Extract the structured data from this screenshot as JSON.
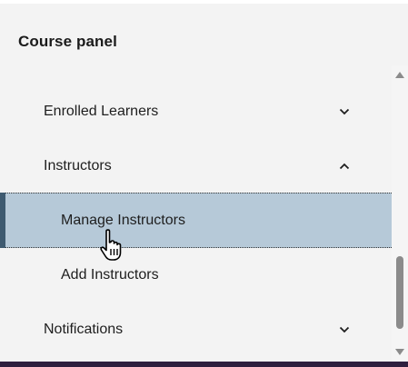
{
  "panel": {
    "title": "Course panel"
  },
  "nav": {
    "enrolled_learners": {
      "label": "Enrolled Learners",
      "icon": "chevron-down-icon",
      "expanded": false
    },
    "instructors": {
      "label": "Instructors",
      "icon": "chevron-up-icon",
      "expanded": true
    },
    "manage_instructors": {
      "label": "Manage Instructors",
      "active": true
    },
    "add_instructors": {
      "label": "Add Instructors",
      "active": false
    },
    "notifications": {
      "label": "Notifications",
      "icon": "chevron-down-icon",
      "expanded": false
    }
  },
  "colors": {
    "background": "#f3f3f3",
    "active_background": "#b6c9d8",
    "active_bar": "#3e5a70",
    "bottom_border": "#2f1f3f",
    "scroll_thumb": "#8b8b8b"
  },
  "cursor": {
    "icon": "hand-pointer-icon"
  }
}
